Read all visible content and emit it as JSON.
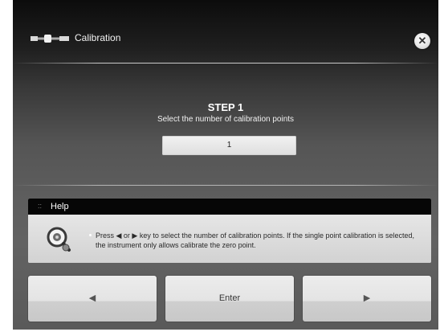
{
  "header": {
    "title": "Calibration",
    "icon": "calibration-tool-icon",
    "close_icon": "close-icon"
  },
  "step": {
    "heading": "STEP 1",
    "instruction": "Select the number of calibration points",
    "value": "1"
  },
  "help": {
    "dots": "::",
    "title": "Help",
    "icon": "magnifier-gear-icon",
    "text": "Press ◀ or ▶ key to select the number of calibration points. If the single point calibration is selected, the instrument only allows calibrate the zero point."
  },
  "buttons": {
    "prev_icon": "◀",
    "enter_label": "Enter",
    "next_icon": "▶"
  }
}
